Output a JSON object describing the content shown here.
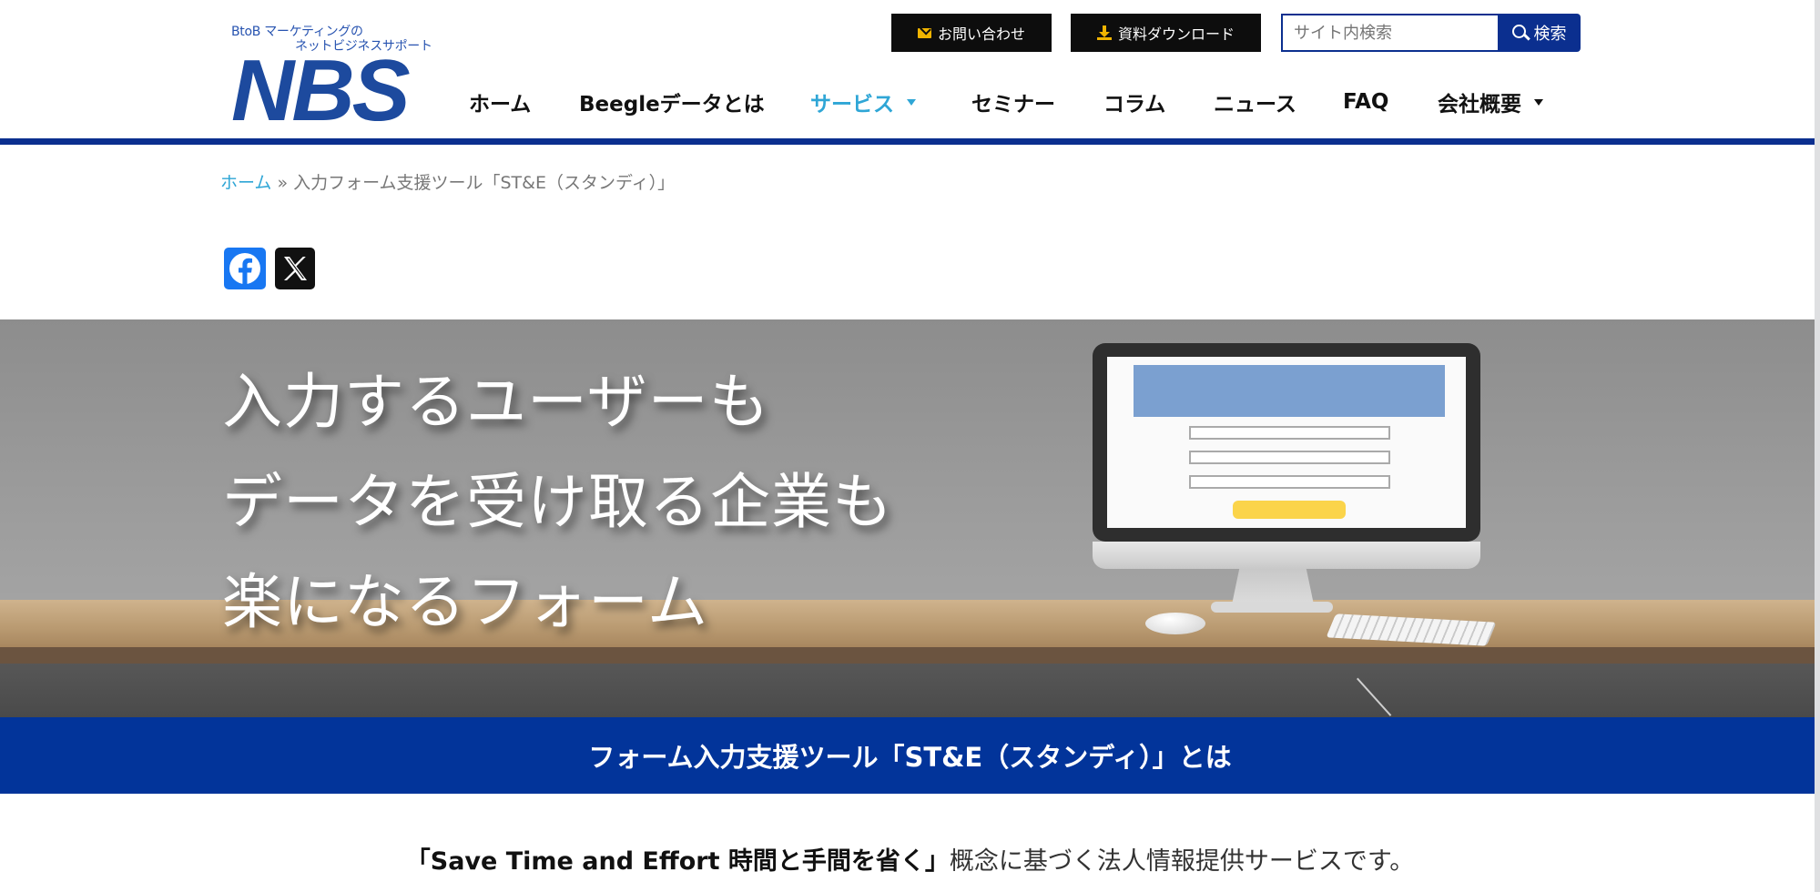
{
  "header": {
    "logo": {
      "tagline_line1": "BtoB マーケティングの",
      "tagline_line2": "ネットビジネスサポート",
      "mark": "NBS"
    },
    "top_buttons": {
      "contact_label": "お問い合わせ",
      "download_label": "資料ダウンロード"
    },
    "search": {
      "placeholder": "サイト内検索",
      "button_label": "検索"
    },
    "nav": [
      {
        "label": "ホーム",
        "dropdown": false,
        "active": false
      },
      {
        "label": "Beegleデータとは",
        "dropdown": false,
        "active": false
      },
      {
        "label": "サービス",
        "dropdown": true,
        "active": true
      },
      {
        "label": "セミナー",
        "dropdown": false,
        "active": false
      },
      {
        "label": "コラム",
        "dropdown": false,
        "active": false
      },
      {
        "label": "ニュース",
        "dropdown": false,
        "active": false
      },
      {
        "label": "FAQ",
        "dropdown": false,
        "active": false
      },
      {
        "label": "会社概要",
        "dropdown": true,
        "active": false
      }
    ]
  },
  "breadcrumb": {
    "home": "ホーム",
    "separator": "»",
    "current": "入力フォーム支援ツール「ST&E（スタンディ）」"
  },
  "share": {
    "icons": [
      "facebook-icon",
      "x-icon"
    ]
  },
  "hero": {
    "lines": [
      "入力するユーザーも",
      "データを受け取る企業も",
      "楽になるフォーム"
    ]
  },
  "section": {
    "title": "フォーム入力支援ツール「ST&E（スタンディ）」とは"
  },
  "intro": {
    "emphasis": "「Save Time and Effort 時間と手間を省く」",
    "rest": "概念に基づく法人情報提供サービスです。"
  },
  "colors": {
    "brand_blue": "#02349a",
    "accent_cyan": "#2fa6d6",
    "icon_yellow": "#f0b400"
  }
}
